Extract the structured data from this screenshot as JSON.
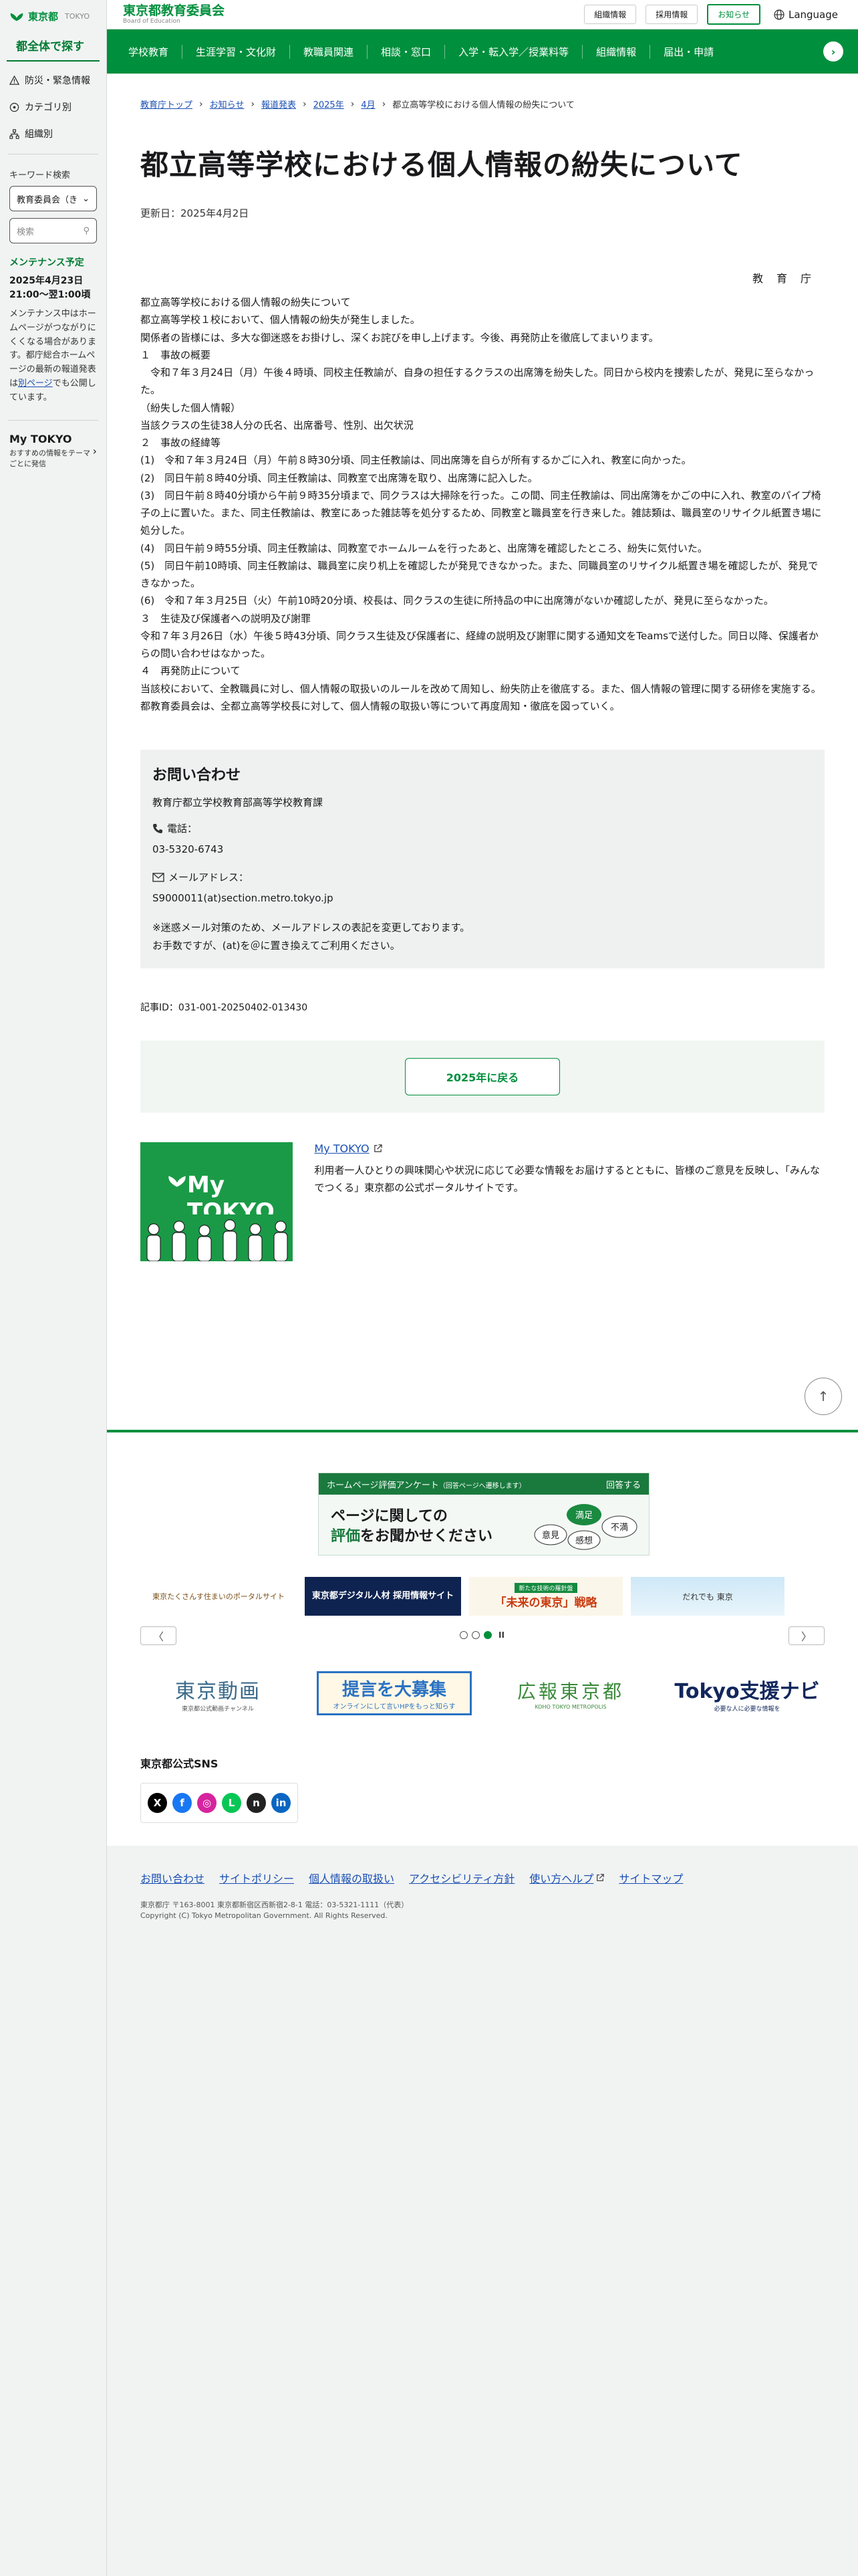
{
  "sidebar": {
    "logo_text": "東京都",
    "logo_sub": "TOKYO",
    "section_title": "都全体で探す",
    "nav": [
      {
        "label": "防災・緊急情報",
        "icon": "warning-icon"
      },
      {
        "label": "カテゴリ別",
        "icon": "category-icon"
      },
      {
        "label": "組織別",
        "icon": "organization-icon"
      }
    ],
    "keyword_label": "キーワード検索",
    "scope_select": "教育委員会（き",
    "search_placeholder": "検索",
    "maintenance_title": "メンテナンス予定",
    "maintenance_date": "2025年4月23日",
    "maintenance_time": "21:00〜翌1:00頃",
    "maintenance_text_1": "メンテナンス中はホームページがつながりにくくなる場合があります。都庁総合ホームページの最新の報道発表は",
    "maintenance_link": "別ページ",
    "maintenance_text_2": "でも公開しています。",
    "mytokyo_title": "My TOKYO",
    "mytokyo_desc": "おすすめの情報をテーマごとに発信"
  },
  "header": {
    "title": "東京都教育委員会",
    "subtitle": "Board of Education",
    "utility": [
      "組織情報",
      "採用情報",
      "お知らせ"
    ],
    "language": "Language"
  },
  "global_nav": [
    "学校教育",
    "生涯学習・文化財",
    "教職員関連",
    "相談・窓口",
    "入学・転入学／授業料等",
    "組織情報",
    "届出・申請"
  ],
  "breadcrumb": [
    "教育庁トップ",
    "お知らせ",
    "報道発表",
    "2025年",
    "4月",
    "都立高等学校における個人情報の紛失について"
  ],
  "article": {
    "title": "都立高等学校における個人情報の紛失について",
    "updated": "更新日：2025年4月2日",
    "signature": "教育庁",
    "lead": "都立高等学校における個人情報の紛失について",
    "intro": [
      "都立高等学校１校において、個人情報の紛失が発生しました。",
      "関係者の皆様には、多大な御迷惑をお掛けし、深くお詫びを申し上げます。今後、再発防止を徹底してまいります。"
    ],
    "s1_head": "１　事故の概要",
    "s1_body": "　令和７年３月24日（月）午後４時頃、同校主任教諭が、自身の担任するクラスの出席簿を紛失した。同日から校内を捜索したが、発見に至らなかった。",
    "s1_sub": "（紛失した個人情報）",
    "s1_detail": "当該クラスの生徒38人分の氏名、出席番号、性別、出欠状況",
    "s2_head": "２　事故の経緯等",
    "s2_items": [
      "(1)　令和７年３月24日（月）午前８時30分頃、同主任教諭は、同出席簿を自らが所有するかごに入れ、教室に向かった。",
      "(2)　同日午前８時40分頃、同主任教諭は、同教室で出席簿を取り、出席簿に記入した。",
      "(3)　同日午前８時40分頃から午前９時35分頃まで、同クラスは大掃除を行った。この間、同主任教諭は、同出席簿をかごの中に入れ、教室のパイプ椅子の上に置いた。また、同主任教諭は、教室にあった雑誌等を処分するため、同教室と職員室を行き来した。雑誌類は、職員室のリサイクル紙置き場に処分した。",
      "(4)　同日午前９時55分頃、同主任教諭は、同教室でホームルームを行ったあと、出席簿を確認したところ、紛失に気付いた。",
      "(5)　同日午前10時頃、同主任教諭は、職員室に戻り机上を確認したが発見できなかった。また、同職員室のリサイクル紙置き場を確認したが、発見できなかった。",
      "(6)　令和７年３月25日（火）午前10時20分頃、校長は、同クラスの生徒に所持品の中に出席簿がないか確認したが、発見に至らなかった。"
    ],
    "s3_head": "３　生徒及び保護者への説明及び謝罪",
    "s3_body": "令和７年３月26日（水）午後５時43分頃、同クラス生徒及び保護者に、経緯の説明及び謝罪に関する通知文をTeamsで送付した。同日以降、保護者からの問い合わせはなかった。",
    "s4_head": "４　再発防止について",
    "s4_body_1": "当該校において、全教職員に対し、個人情報の取扱いのルールを改めて周知し、紛失防止を徹底する。また、個人情報の管理に関する研修を実施する。",
    "s4_body_2": "都教育委員会は、全都立高等学校長に対して、個人情報の取扱い等について再度周知・徹底を図っていく。"
  },
  "contact": {
    "heading": "お問い合わせ",
    "org": "教育庁都立学校教育部高等学校教育課",
    "phone_label": "電話：",
    "phone": "03-5320-6743",
    "mail_label": "メールアドレス：",
    "mail": "S9000011(at)section.metro.tokyo.jp",
    "note_1": "※迷惑メール対策のため、メールアドレスの表記を変更しております。",
    "note_2": "お手数ですが、(at)を＠に置き換えてご利用ください。"
  },
  "article_id": "記事ID：031-001-20250402-013430",
  "back_button": "2025年に戻る",
  "promo": {
    "image_text": "My TOKYO",
    "link": "My TOKYO",
    "desc": "利用者一人ひとりの興味関心や状況に応じて必要な情報をお届けするとともに、皆様のご意見を反映し、「みんなでつくる」東京都の公式ポータルサイトです。"
  },
  "survey": {
    "bar_title": "ホームページ評価アンケート",
    "bar_note": "（回答ページへ遷移します）",
    "bar_action": "回答する",
    "line1": "ページに関しての",
    "line2_green": "評価",
    "line2_rest": "をお聞かせください",
    "bubbles": [
      "満足",
      "意見",
      "感想",
      "不満"
    ]
  },
  "banners_row1": [
    {
      "text": "東京たくさんす住まいのポータルサイト"
    },
    {
      "text": "東京都デジタル人材 採用情報サイト"
    },
    {
      "tag": "新たな技術の羅針盤",
      "text": "「未来の東京」戦略"
    },
    {
      "text": "だれでも 東京"
    }
  ],
  "carousel": {
    "prev": "〈",
    "next": "〉",
    "pause": "II"
  },
  "banners_row2": [
    {
      "title": "東京動画",
      "sub": "東京都公式動画チャンネル"
    },
    {
      "title": "提言を大募集",
      "sub": "オンラインにして言いHPをもっと知らす"
    },
    {
      "title": "広報東京都",
      "sub": "KOHO TOKYO METROPOLIS"
    },
    {
      "title": "Tokyo支援ナビ",
      "sub": "必要な人に必要な情報を"
    }
  ],
  "sns": {
    "title": "東京都公式SNS",
    "items": [
      {
        "name": "x-icon",
        "glyph": "X",
        "color": "#000000"
      },
      {
        "name": "facebook-icon",
        "glyph": "f",
        "color": "#1877f2"
      },
      {
        "name": "instagram-icon",
        "glyph": "◎",
        "color": "#d6249f"
      },
      {
        "name": "line-icon",
        "glyph": "L",
        "color": "#06c755"
      },
      {
        "name": "note-icon",
        "glyph": "n",
        "color": "#222222"
      },
      {
        "name": "linkedin-icon",
        "glyph": "in",
        "color": "#0a66c2"
      }
    ]
  },
  "footer": {
    "links": [
      "お問い合わせ",
      "サイトポリシー",
      "個人情報の取扱い",
      "アクセシビリティ方針",
      "使い方ヘルプ",
      "サイトマップ"
    ],
    "address": "東京都庁 〒163-8001 東京都新宿区西新宿2-8-1 電話：03-5321-1111（代表）",
    "copyright": "Copyright (C) Tokyo Metropolitan Government. All Rights Reserved."
  },
  "colors": {
    "brand": "#008f3d",
    "link": "#1a4fb3"
  }
}
